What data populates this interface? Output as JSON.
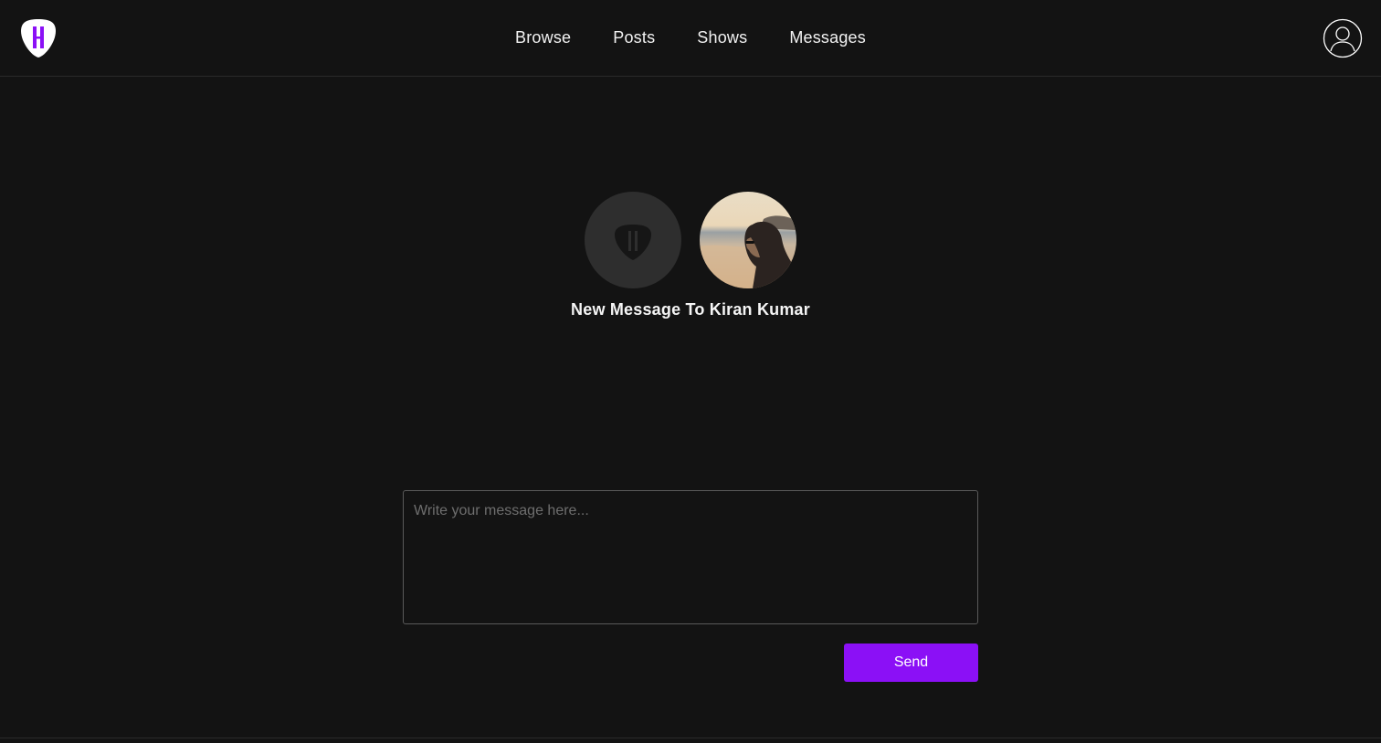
{
  "header": {
    "nav": [
      {
        "label": "Browse"
      },
      {
        "label": "Posts"
      },
      {
        "label": "Shows"
      },
      {
        "label": "Messages"
      }
    ]
  },
  "icons": {
    "logo": "guitar-pick-logo-icon",
    "profile": "user-profile-icon",
    "sender_avatar": "guitar-pick-logo-icon"
  },
  "conversation": {
    "title": "New Message To Kiran Kumar"
  },
  "composer": {
    "placeholder": "Write your message here...",
    "value": "",
    "send_label": "Send"
  },
  "colors": {
    "background": "#131313",
    "accent": "#8b10f6",
    "border": "#5a5a5a",
    "divider": "#2a2a2a"
  }
}
